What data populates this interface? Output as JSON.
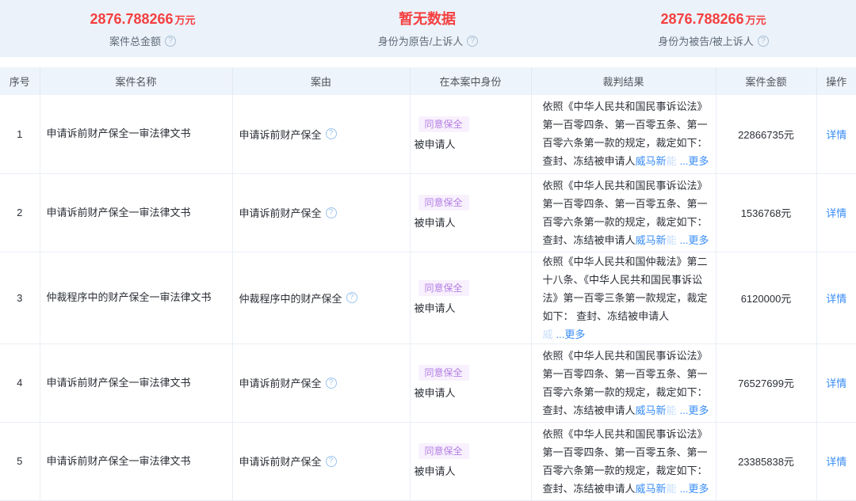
{
  "summary": {
    "stats": [
      {
        "value": "2876.788266",
        "unit": "万元",
        "label": "案件总金额"
      },
      {
        "value": "暂无数据",
        "unit": "",
        "label": "身份为原告/上诉人"
      },
      {
        "value": "2876.788266",
        "unit": "万元",
        "label": "身份为被告/被上诉人"
      }
    ]
  },
  "table": {
    "columns": [
      "序号",
      "案件名称",
      "案由",
      "在本案中身份",
      "裁判结果",
      "案件金额",
      "操作"
    ],
    "rows": [
      {
        "no": "1",
        "name": "申请诉前财产保全一审法律文书",
        "cause": "申请诉前财产保全",
        "tag": "同意保全",
        "identity": "被申请人",
        "result_text": "依照《中华人民共和国民事诉讼法》第一百零四条、第一百零五条、第一百零六条第一款的规定，裁定如下：查封、冻结被申请人",
        "result_link": "威马新",
        "result_link_fade": "能",
        "more": "...更多",
        "amount": "22866735元",
        "action": "详情"
      },
      {
        "no": "2",
        "name": "申请诉前财产保全一审法律文书",
        "cause": "申请诉前财产保全",
        "tag": "同意保全",
        "identity": "被申请人",
        "result_text": "依照《中华人民共和国民事诉讼法》第一百零四条、第一百零五条、第一百零六条第一款的规定，裁定如下：查封、冻结被申请人",
        "result_link": "威马新",
        "result_link_fade": "能",
        "more": "...更多",
        "amount": "1536768元",
        "action": "详情"
      },
      {
        "no": "3",
        "name": "仲裁程序中的财产保全一审法律文书",
        "cause": "仲裁程序中的财产保全",
        "tag": "同意保全",
        "identity": "被申请人",
        "result_text": "依照《中华人民共和国仲裁法》第二十八条、《中华人民共和国民事诉讼法》第一百零三条第一款规定，裁定如下： 查封、冻结被申请人",
        "result_link": "",
        "result_link_fade": "威",
        "more": "...更多",
        "amount": "6120000元",
        "action": "详情"
      },
      {
        "no": "4",
        "name": "申请诉前财产保全一审法律文书",
        "cause": "申请诉前财产保全",
        "tag": "同意保全",
        "identity": "被申请人",
        "result_text": "依照《中华人民共和国民事诉讼法》第一百零四条、第一百零五条、第一百零六条第一款的规定，裁定如下：查封、冻结被申请人",
        "result_link": "威马新",
        "result_link_fade": "能",
        "more": "...更多",
        "amount": "76527699元",
        "action": "详情"
      },
      {
        "no": "5",
        "name": "申请诉前财产保全一审法律文书",
        "cause": "申请诉前财产保全",
        "tag": "同意保全",
        "identity": "被申请人",
        "result_text": "依照《中华人民共和国民事诉讼法》第一百零四条、第一百零五条、第一百零六条第一款的规定，裁定如下：查封、冻结被申请人",
        "result_link": "威马新",
        "result_link_fade": "能",
        "more": "...更多",
        "amount": "23385838元",
        "action": "详情"
      }
    ]
  },
  "icons": {
    "help": "?"
  },
  "colors": {
    "stat_red": "#f53f3f",
    "link_blue": "#378cf7",
    "tag_text": "#b37fe3",
    "tag_bg": "#f8f1fd",
    "band_bg": "#ebf2fa",
    "header_bg": "#eef4fb"
  }
}
